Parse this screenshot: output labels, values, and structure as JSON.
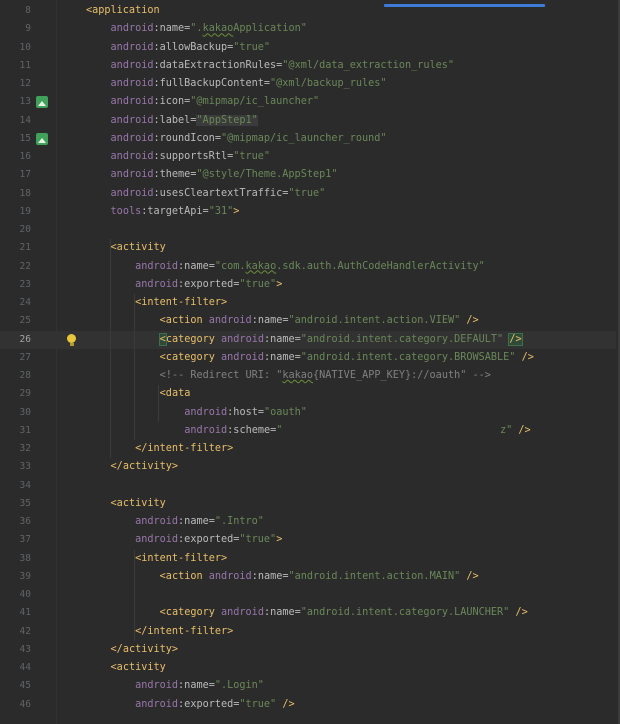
{
  "editor": {
    "lines": [
      {
        "num": "8",
        "text": "<application"
      },
      {
        "num": "9",
        "text": "android:name=\".kakaoApplication\""
      },
      {
        "num": "10",
        "text": "android:allowBackup=\"true\""
      },
      {
        "num": "11",
        "text": "android:dataExtractionRules=\"@xml/data_extraction_rules\""
      },
      {
        "num": "12",
        "text": "android:fullBackupContent=\"@xml/backup_rules\""
      },
      {
        "num": "13",
        "text": "android:icon=\"@mipmap/ic_launcher\""
      },
      {
        "num": "14",
        "text": "android:label=\"AppStep1\""
      },
      {
        "num": "15",
        "text": "android:roundIcon=\"@mipmap/ic_launcher_round\""
      },
      {
        "num": "16",
        "text": "android:supportsRtl=\"true\""
      },
      {
        "num": "17",
        "text": "android:theme=\"@style/Theme.AppStep1\""
      },
      {
        "num": "18",
        "text": "android:usesCleartextTraffic=\"true\""
      },
      {
        "num": "19",
        "text": "tools:targetApi=\"31\">"
      },
      {
        "num": "20",
        "text": ""
      },
      {
        "num": "21",
        "text": "<activity"
      },
      {
        "num": "22",
        "text": "android:name=\"com.kakao.sdk.auth.AuthCodeHandlerActivity\""
      },
      {
        "num": "23",
        "text": "android:exported=\"true\">"
      },
      {
        "num": "24",
        "text": "<intent-filter>"
      },
      {
        "num": "25",
        "text": "<action android:name=\"android.intent.action.VIEW\" />"
      },
      {
        "num": "26",
        "text": "<category android:name=\"android.intent.category.DEFAULT\" />"
      },
      {
        "num": "27",
        "text": "<category android:name=\"android.intent.category.BROWSABLE\" />"
      },
      {
        "num": "28",
        "text": "<!-- Redirect URI: \"kakao{NATIVE_APP_KEY}://oauth\" -->"
      },
      {
        "num": "29",
        "text": "<data"
      },
      {
        "num": "30",
        "text": "android:host=\"oauth\""
      },
      {
        "num": "31",
        "text": "android:scheme=\""
      },
      {
        "num": "32",
        "text": "</intent-filter>"
      },
      {
        "num": "33",
        "text": "</activity>"
      },
      {
        "num": "34",
        "text": ""
      },
      {
        "num": "35",
        "text": "<activity"
      },
      {
        "num": "36",
        "text": "android:name=\".Intro\""
      },
      {
        "num": "37",
        "text": "android:exported=\"true\">"
      },
      {
        "num": "38",
        "text": "<intent-filter>"
      },
      {
        "num": "39",
        "text": "<action android:name=\"android.intent.action.MAIN\" />"
      },
      {
        "num": "40",
        "text": ""
      },
      {
        "num": "41",
        "text": "<category android:name=\"android.intent.category.LAUNCHER\" />"
      },
      {
        "num": "42",
        "text": "</intent-filter>"
      },
      {
        "num": "43",
        "text": "</activity>"
      },
      {
        "num": "44",
        "text": "<activity"
      },
      {
        "num": "45",
        "text": "android:name=\".Login\""
      },
      {
        "num": "46",
        "text": "android:exported=\"true\" />"
      }
    ],
    "scheme_tail": "z\" />",
    "current_line": "26",
    "colors": {
      "background": "#2b2b2b",
      "tag": "#e8bf6a",
      "namespace": "#9876aa",
      "attribute": "#bababa",
      "value": "#6a8759",
      "comment": "#808080",
      "scroll_indicator": "#3d7bd9",
      "gutter_icon": "#3fa15a",
      "bulb": "#e8c53a"
    },
    "icons": {
      "line_13": "image-resource-icon",
      "line_15": "image-resource-icon",
      "line_26": "lightbulb-icon"
    }
  }
}
